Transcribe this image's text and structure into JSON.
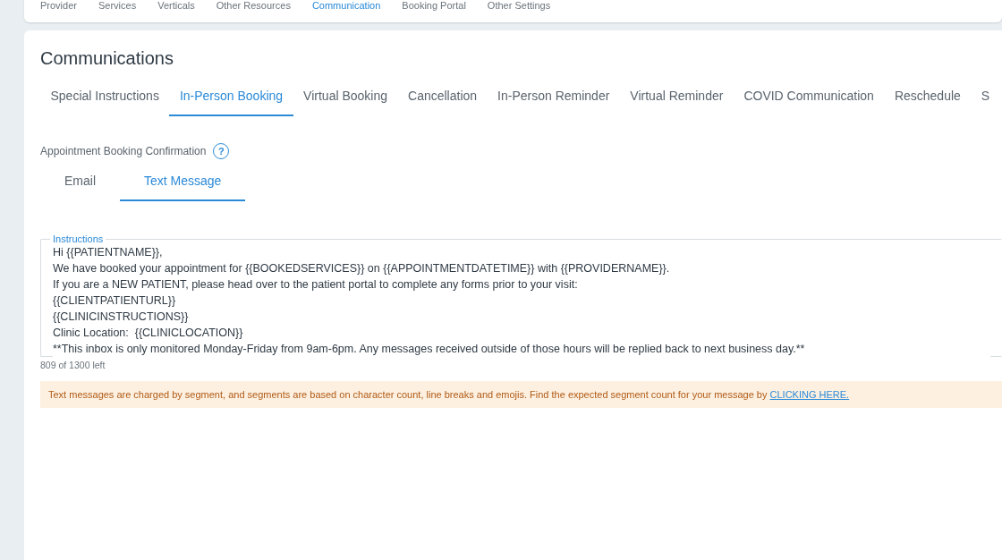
{
  "top_nav": [
    {
      "label": "Provider",
      "selected": false
    },
    {
      "label": "Services",
      "selected": false
    },
    {
      "label": "Verticals",
      "selected": false
    },
    {
      "label": "Other Resources",
      "selected": false
    },
    {
      "label": "Communication",
      "selected": true
    },
    {
      "label": "Booking Portal",
      "selected": false
    },
    {
      "label": "Other Settings",
      "selected": false
    }
  ],
  "title": "Communications",
  "tabs": [
    {
      "label": "Special Instructions",
      "selected": false
    },
    {
      "label": "In-Person Booking",
      "selected": true
    },
    {
      "label": "Virtual Booking",
      "selected": false
    },
    {
      "label": "Cancellation",
      "selected": false
    },
    {
      "label": "In-Person Reminder",
      "selected": false
    },
    {
      "label": "Virtual Reminder",
      "selected": false
    },
    {
      "label": "COVID Communication",
      "selected": false
    },
    {
      "label": "Reschedule",
      "selected": false
    },
    {
      "label": "S",
      "selected": false
    }
  ],
  "section_label": "Appointment Booking Confirmation",
  "help_icon": "?",
  "channel_tabs": [
    {
      "label": "Email",
      "selected": false
    },
    {
      "label": "Text Message",
      "selected": true
    }
  ],
  "instructions": {
    "label": "Instructions",
    "lines": [
      "Hi {{PATIENTNAME}},",
      "We have booked your appointment for {{BOOKEDSERVICES}} on {{APPOINTMENTDATETIME}} with {{PROVIDERNAME}}.",
      "If you are a NEW PATIENT, please head over to the patient portal to complete any forms prior to your visit:",
      "{{CLIENTPATIENTURL}}",
      "{{CLINICINSTRUCTIONS}}",
      "Clinic Location:  {{CLINICLOCATION}}",
      "**This inbox is only monitored Monday-Friday from 9am-6pm. Any messages received outside of those hours will be replied back to next business day.**"
    ],
    "counter": "809 of 1300 left"
  },
  "notice": {
    "text": "Text messages are charged by segment, and segments are based on character count, line breaks and emojis. Find the expected segment count for your message by",
    "link": "CLICKING HERE."
  }
}
